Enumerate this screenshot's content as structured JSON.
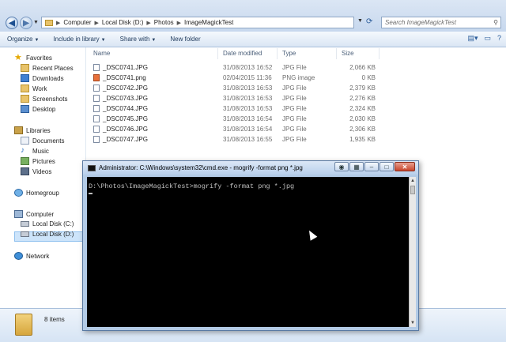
{
  "address": {
    "crumbs": [
      "Computer",
      "Local Disk (D:)",
      "Photos",
      "ImageMagickTest"
    ],
    "search_placeholder": "Search ImageMagickTest"
  },
  "toolbar": {
    "organize": "Organize",
    "include": "Include in library",
    "share": "Share with",
    "new_folder": "New folder"
  },
  "nav": {
    "favorites": "Favorites",
    "recent": "Recent Places",
    "downloads": "Downloads",
    "work": "Work",
    "screenshots": "Screenshots",
    "desktop": "Desktop",
    "libraries": "Libraries",
    "documents": "Documents",
    "music": "Music",
    "pictures": "Pictures",
    "videos": "Videos",
    "homegroup": "Homegroup",
    "computer": "Computer",
    "disk_c": "Local Disk (C:)",
    "disk_d": "Local Disk (D:)",
    "network": "Network"
  },
  "columns": {
    "name": "Name",
    "date": "Date modified",
    "type": "Type",
    "size": "Size"
  },
  "files": [
    {
      "name": "_DSC0741.JPG",
      "date": "31/08/2013 16:52",
      "type": "JPG File",
      "size": "2,066 KB"
    },
    {
      "name": "_DSC0741.png",
      "date": "02/04/2015 11:36",
      "type": "PNG image",
      "size": "0 KB"
    },
    {
      "name": "_DSC0742.JPG",
      "date": "31/08/2013 16:53",
      "type": "JPG File",
      "size": "2,379 KB"
    },
    {
      "name": "_DSC0743.JPG",
      "date": "31/08/2013 16:53",
      "type": "JPG File",
      "size": "2,276 KB"
    },
    {
      "name": "_DSC0744.JPG",
      "date": "31/08/2013 16:53",
      "type": "JPG File",
      "size": "2,324 KB"
    },
    {
      "name": "_DSC0745.JPG",
      "date": "31/08/2013 16:54",
      "type": "JPG File",
      "size": "2,030 KB"
    },
    {
      "name": "_DSC0746.JPG",
      "date": "31/08/2013 16:54",
      "type": "JPG File",
      "size": "2,306 KB"
    },
    {
      "name": "_DSC0747.JPG",
      "date": "31/08/2013 16:55",
      "type": "JPG File",
      "size": "1,935 KB"
    }
  ],
  "status": {
    "count": "8 items"
  },
  "cmd": {
    "title": "Administrator: C:\\Windows\\system32\\cmd.exe - mogrify  -format png *.jpg",
    "line": "D:\\Photos\\ImageMagickTest>mogrify -format png *.jpg"
  }
}
